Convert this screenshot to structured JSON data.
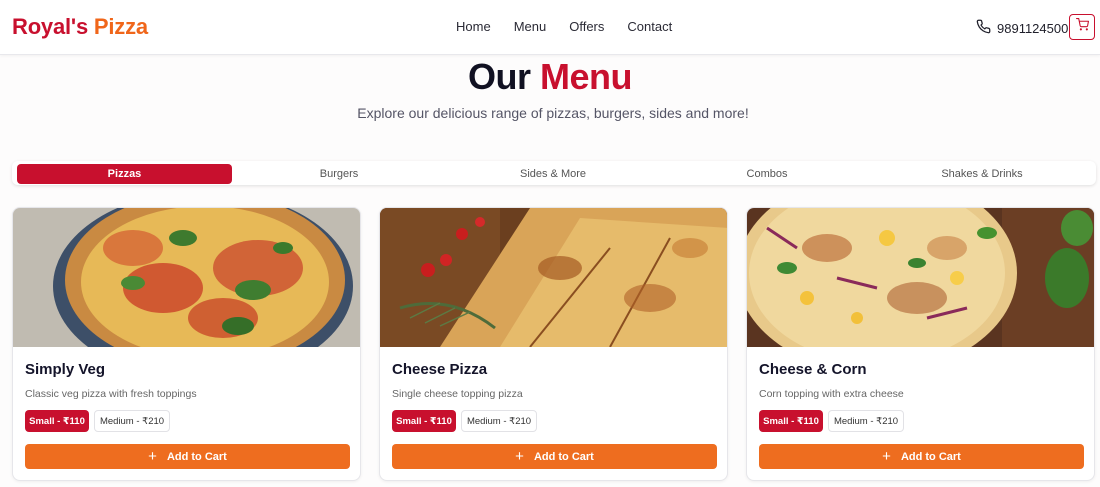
{
  "header": {
    "logo_part1": "Royal's",
    "logo_part2": "Pizza",
    "nav": [
      "Home",
      "Menu",
      "Offers",
      "Contact"
    ],
    "phone": "9891124500"
  },
  "hero": {
    "title_part1": "Our",
    "title_part2": "Menu",
    "subtitle": "Explore our delicious range of pizzas, burgers, sides and more!"
  },
  "tabs": {
    "items": [
      "Pizzas",
      "Burgers",
      "Sides & More",
      "Combos",
      "Shakes & Drinks"
    ],
    "active": "Pizzas"
  },
  "cards": [
    {
      "name": "Simply Veg",
      "desc": "Classic veg pizza with fresh toppings",
      "size_selected": "Small - ₹110",
      "size_other": "Medium - ₹210",
      "add_label": "Add to Cart"
    },
    {
      "name": "Cheese Pizza",
      "desc": "Single cheese topping pizza",
      "size_selected": "Small - ₹110",
      "size_other": "Medium - ₹210",
      "add_label": "Add to Cart"
    },
    {
      "name": "Cheese & Corn",
      "desc": "Corn topping with extra cheese",
      "size_selected": "Small - ₹110",
      "size_other": "Medium - ₹210",
      "add_label": "Add to Cart"
    }
  ],
  "colors": {
    "brand_red": "#c8102e",
    "brand_orange": "#ee6d1f"
  },
  "icons": {
    "phone": "phone-icon",
    "cart": "cart-icon",
    "plus": "plus-icon"
  }
}
